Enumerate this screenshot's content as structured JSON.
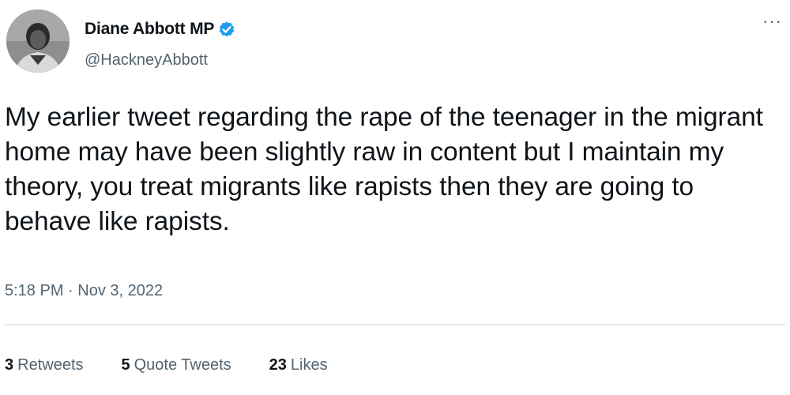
{
  "author": {
    "display_name": "Diane Abbott MP",
    "handle": "@HackneyAbbott",
    "verified_icon": "verified-badge-icon",
    "verified_color": "#1d9bf0"
  },
  "tweet": {
    "text": "My earlier tweet regarding the rape of the teenager in the migrant home may have been slightly raw in content but I maintain my theory, you treat migrants like rapists then they are going to behave like rapists.",
    "timestamp": "5:18 PM · Nov 3, 2022",
    "more_label": "···"
  },
  "stats": [
    {
      "count": "3",
      "label": "Retweets"
    },
    {
      "count": "5",
      "label": "Quote Tweets"
    },
    {
      "count": "23",
      "label": "Likes"
    }
  ],
  "colors": {
    "text_primary": "#0f1419",
    "text_secondary": "#536471",
    "divider": "#e3e6e8"
  }
}
